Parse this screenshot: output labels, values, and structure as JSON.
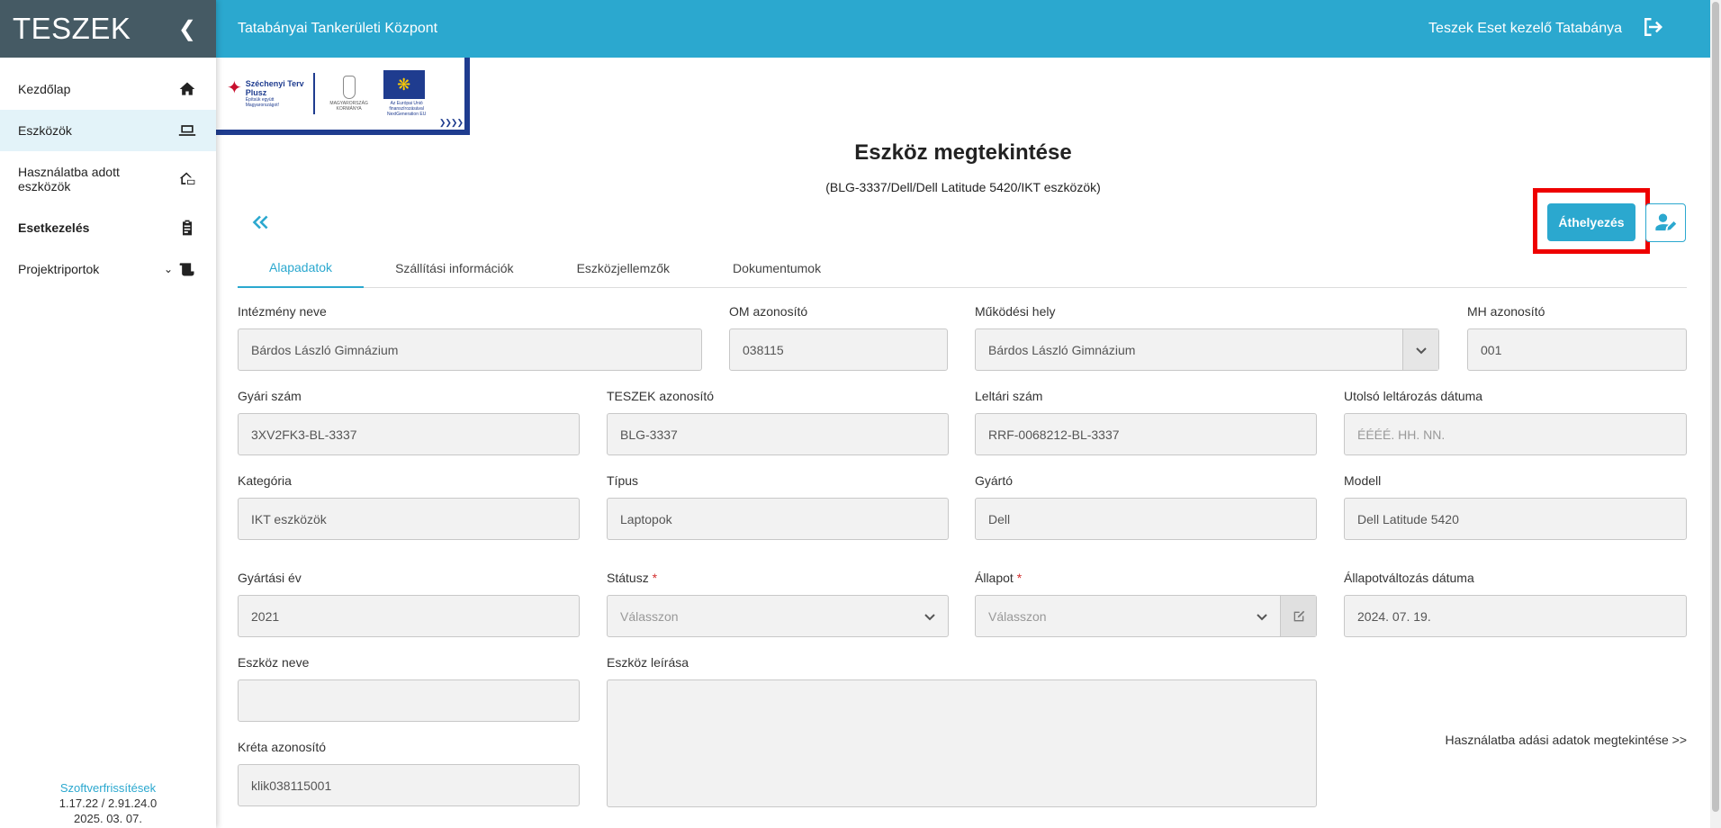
{
  "app": {
    "brand": "TESZEK",
    "topbar_title": "Tatabányai Tankerületi Központ",
    "user_label": "Teszek Eset kezelő Tatabánya"
  },
  "sidebar": {
    "items": [
      {
        "label": "Kezdőlap",
        "icon": "home-icon"
      },
      {
        "label": "Eszközök",
        "icon": "laptop-icon"
      },
      {
        "label": "Használatba adott eszközök",
        "icon": "house-laptop-icon"
      },
      {
        "label": "Esetkezelés",
        "icon": "clipboard-icon"
      },
      {
        "label": "Projektriportok",
        "icon": "scroll-icon"
      }
    ],
    "footer": {
      "link": "Szoftverfrissítések",
      "version": "1.17.22 / 2.91.24.0",
      "date": "2025. 03. 07."
    }
  },
  "logos": {
    "szechenyi_line1": "Széchenyi Terv",
    "szechenyi_line2": "Plusz",
    "szechenyi_small": "Építsük együtt Magyarországot!",
    "gov": "MAGYARORSZÁG KORMÁNYA",
    "eu": "Az Európai Unió finanszírozásával NextGeneration EU"
  },
  "page": {
    "title": "Eszköz megtekintése",
    "subtitle": "(BLG-3337/Dell/Dell Latitude 5420/IKT eszközök)",
    "transfer_button": "Áthelyezés"
  },
  "tabs": [
    {
      "label": "Alapadatok",
      "active": true
    },
    {
      "label": "Szállítási információk",
      "active": false
    },
    {
      "label": "Eszközjellemzők",
      "active": false
    },
    {
      "label": "Dokumentumok",
      "active": false
    }
  ],
  "form": {
    "intezmeny_neve": {
      "label": "Intézmény neve",
      "value": "Bárdos László Gimnázium"
    },
    "om_azonosito": {
      "label": "OM azonosító",
      "value": "038115"
    },
    "mukodesi_hely": {
      "label": "Működési hely",
      "value": "Bárdos László Gimnázium"
    },
    "mh_azonosito": {
      "label": "MH azonosító",
      "value": "001"
    },
    "gyari_szam": {
      "label": "Gyári szám",
      "value": "3XV2FK3-BL-3337"
    },
    "teszek_azonosito": {
      "label": "TESZEK azonosító",
      "value": "BLG-3337"
    },
    "leltari_szam": {
      "label": "Leltári szám",
      "value": "RRF-0068212-BL-3337"
    },
    "utolso_leltarozas": {
      "label": "Utolsó leltározás dátuma",
      "placeholder": "ÉÉÉÉ. HH. NN."
    },
    "kategoria": {
      "label": "Kategória",
      "value": "IKT eszközök"
    },
    "tipus": {
      "label": "Típus",
      "value": "Laptopok"
    },
    "gyarto": {
      "label": "Gyártó",
      "value": "Dell"
    },
    "modell": {
      "label": "Modell",
      "value": "Dell Latitude 5420"
    },
    "gyartasi_ev": {
      "label": "Gyártási év",
      "value": "2021"
    },
    "statusz": {
      "label": "Státusz",
      "required": "*",
      "value": "Válasszon"
    },
    "allapot": {
      "label": "Állapot",
      "required": "*",
      "value": "Válasszon"
    },
    "allapotvaltozas": {
      "label": "Állapotváltozás dátuma",
      "value": "2024. 07. 19."
    },
    "eszkoz_neve": {
      "label": "Eszköz neve",
      "value": ""
    },
    "eszkoz_leirasa": {
      "label": "Eszköz leírása",
      "value": ""
    },
    "kreta_azonosito": {
      "label": "Kréta azonosító",
      "value": "klik038115001"
    }
  },
  "usage_link": "Használatba adási adatok megtekintése >>",
  "colors": {
    "accent": "#2ba8cf",
    "sidebar_header": "#455a64",
    "highlight": "#ee0000",
    "eu_blue": "#1f3c8f"
  }
}
